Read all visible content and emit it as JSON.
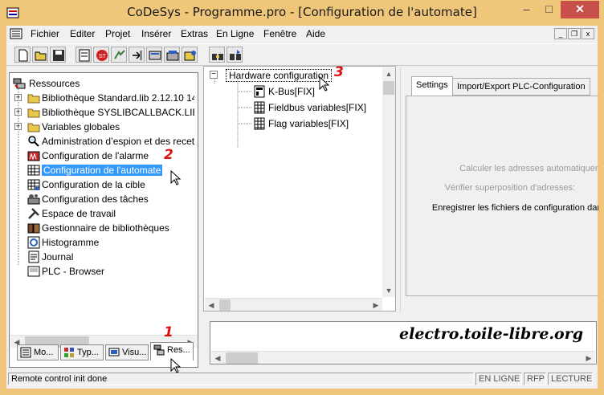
{
  "window": {
    "title": "CoDeSys - Programme.pro - [Configuration de l'automate]",
    "min_glyph": "–",
    "max_glyph": "□",
    "close_glyph": "✕"
  },
  "menu": {
    "items": [
      "Fichier",
      "Editer",
      "Projet",
      "Insérer",
      "Extras",
      "En Ligne",
      "Fenêtre",
      "Aide"
    ],
    "mdi_min": "_",
    "mdi_restore": "❐",
    "mdi_close": "x"
  },
  "toolbar": {
    "buttons": [
      "new-icon",
      "open-icon",
      "save-icon",
      "compile-icon",
      "stop-icon",
      "login-icon",
      "logout-icon",
      "download-icon",
      "run-icon",
      "step-icon",
      "find-icon",
      "find-next-icon"
    ]
  },
  "resources_tree": {
    "root": "Ressources",
    "items": [
      {
        "label": "Bibliothèque Standard.lib 2.12.10 14:",
        "icon": "folder-icon",
        "expandable": true
      },
      {
        "label": "Bibliothèque SYSLIBCALLBACK.LIB",
        "icon": "folder-icon",
        "expandable": true
      },
      {
        "label": "Variables globales",
        "icon": "folder-icon",
        "expandable": true
      },
      {
        "label": "Administration d’espion et des recette",
        "icon": "magnifier-icon",
        "expandable": false
      },
      {
        "label": "Configuration de l'alarme",
        "icon": "alarm-icon",
        "expandable": false
      },
      {
        "label": "Configuration de l'automate",
        "icon": "plc-config-icon",
        "expandable": false,
        "selected": true
      },
      {
        "label": "Configuration de la cible",
        "icon": "target-config-icon",
        "expandable": false
      },
      {
        "label": "Configuration des tâches",
        "icon": "tasks-icon",
        "expandable": false
      },
      {
        "label": "Espace de travail",
        "icon": "tools-icon",
        "expandable": false
      },
      {
        "label": "Gestionnaire de bibliothèques",
        "icon": "library-manager-icon",
        "expandable": false
      },
      {
        "label": "Histogramme",
        "icon": "histogram-icon",
        "expandable": false
      },
      {
        "label": "Journal",
        "icon": "log-icon",
        "expandable": false
      },
      {
        "label": "PLC - Browser",
        "icon": "plc-browser-icon",
        "expandable": false
      }
    ]
  },
  "left_tabs": [
    {
      "label": "Mo...",
      "icon": "pous-icon",
      "active": false
    },
    {
      "label": "Typ...",
      "icon": "data-types-icon",
      "active": false
    },
    {
      "label": "Visu...",
      "icon": "visualization-icon",
      "active": false
    },
    {
      "label": "Res...",
      "icon": "resources-icon",
      "active": true
    }
  ],
  "hw_tree": {
    "root": "Hardware configuration",
    "children": [
      "K-Bus[FIX]",
      "Fieldbus variables[FIX]",
      "Flag variables[FIX]"
    ]
  },
  "right_panel": {
    "tabs": [
      {
        "label": "Settings",
        "active": true
      },
      {
        "label": "Import/Export PLC-Configuration",
        "active": false
      }
    ],
    "options": [
      {
        "label": "Calculer les adresses automatiquen",
        "enabled": false
      },
      {
        "label": "Vérifier superposition d'adresses:",
        "enabled": false
      },
      {
        "label": "Enregistrer les fichiers de configuration dar",
        "enabled": true
      }
    ]
  },
  "statusbar": {
    "message": "Remote control init done",
    "indicators": [
      "EN LIGNE",
      "RFP",
      "LECTURE"
    ]
  },
  "watermark": "electro.toile-libre.org",
  "annotations": [
    "1",
    "2",
    "3"
  ],
  "colors": {
    "title_bar": "#f0c67a",
    "close_button": "#c7504b",
    "selection": "#3399ff",
    "annotation": "#e01010"
  }
}
